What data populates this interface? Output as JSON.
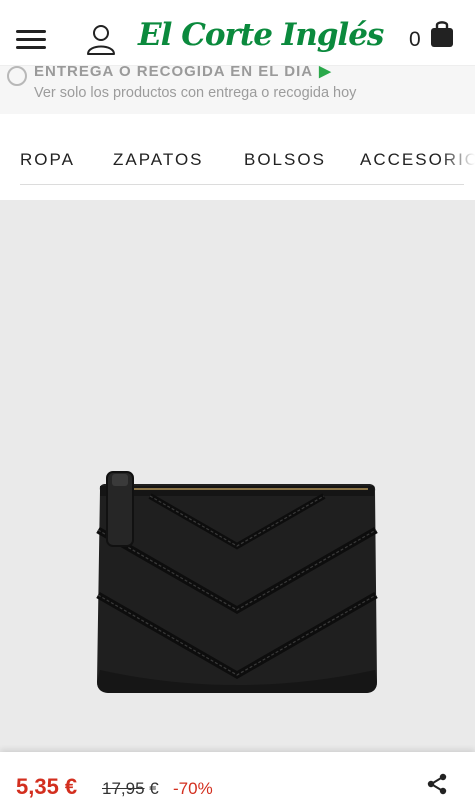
{
  "header": {
    "logo_text": "El Corte Inglés",
    "cart_count": "0",
    "brand_color": "#0b8a3d"
  },
  "filter": {
    "title": "ENTREGA O RECOGIDA EN EL DÍA",
    "subtitle": "Ver solo los productos con entrega o recogida hoy"
  },
  "categories": [
    {
      "label": "ROPA"
    },
    {
      "label": "ZAPATOS"
    },
    {
      "label": "BOLSOS"
    },
    {
      "label": "ACCESORIOS"
    }
  ],
  "product": {
    "price": "5,35 €",
    "old_price": "17,95",
    "old_price_currency": "€",
    "discount": "-70%",
    "price_color": "#d32f1f"
  }
}
